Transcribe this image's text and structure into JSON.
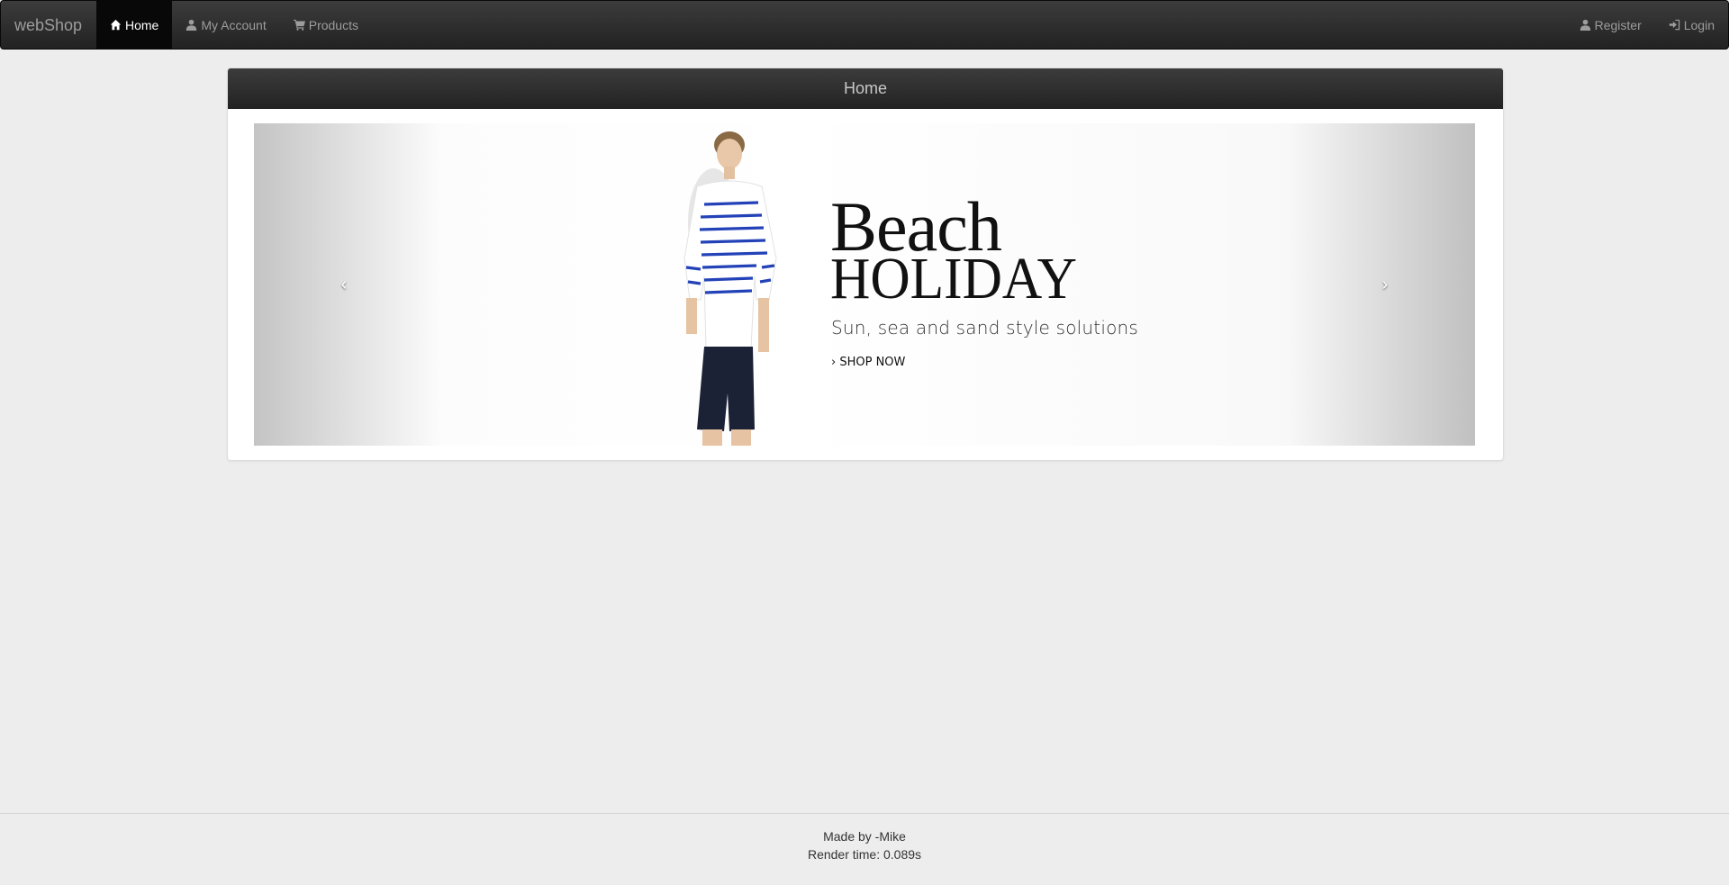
{
  "navbar": {
    "brand": "webShop",
    "left_items": [
      {
        "label": "Home",
        "icon": "home-icon",
        "active": true
      },
      {
        "label": "My Account",
        "icon": "user-icon",
        "active": false
      },
      {
        "label": "Products",
        "icon": "cart-icon",
        "active": false
      }
    ],
    "right_items": [
      {
        "label": "Register",
        "icon": "user-icon"
      },
      {
        "label": "Login",
        "icon": "login-icon"
      }
    ],
    "colors": {
      "background": "#222222",
      "active": "#080808",
      "text": "#9d9d9d"
    }
  },
  "panel": {
    "heading": "Home"
  },
  "carousel": {
    "prev_label": "‹",
    "next_label": "›",
    "slide": {
      "headline_line1": "Beach",
      "headline_line2": "HOLIDAY",
      "tagline": "Sun, sea and sand style solutions",
      "cta": "› SHOP NOW"
    }
  },
  "footer": {
    "made_by": "Made by -Mike",
    "render_time": "Render time: 0.089s"
  }
}
